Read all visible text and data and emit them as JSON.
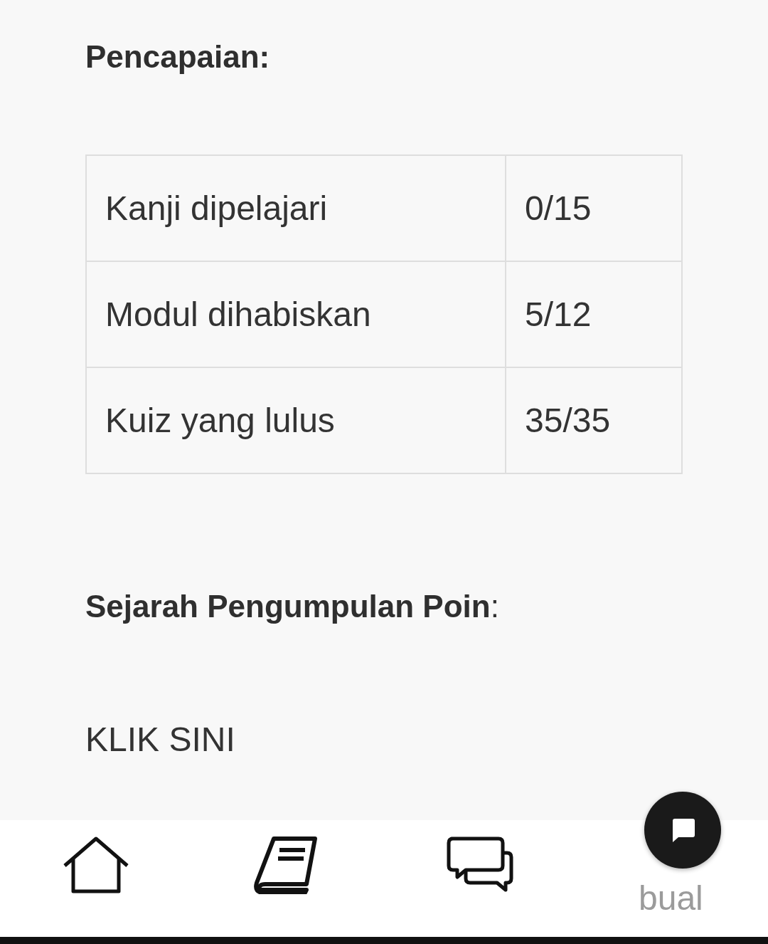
{
  "achievements": {
    "title": "Pencapaian:",
    "rows": [
      {
        "label": "Kanji dipelajari",
        "value": "0/15"
      },
      {
        "label": "Modul dihabiskan",
        "value": "5/12"
      },
      {
        "label": "Kuiz yang lulus",
        "value": "35/35"
      }
    ]
  },
  "history": {
    "title": "**Sejarah Pengumpulan Poin**:",
    "link": "KLIK SINI"
  },
  "bottom_nav": {
    "items": [
      {
        "kind": "home"
      },
      {
        "kind": "book"
      },
      {
        "kind": "chat"
      }
    ],
    "chat_button": {
      "label": "bual"
    }
  }
}
